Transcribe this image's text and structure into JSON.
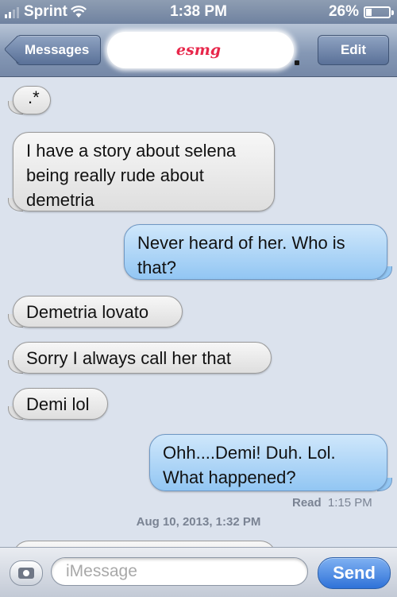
{
  "status_bar": {
    "carrier": "Sprint",
    "time": "1:38 PM",
    "battery_percent": "26%",
    "battery_level": 0.26,
    "signal_bars": 2,
    "wifi_icon": "wifi-icon"
  },
  "nav": {
    "back_label": "Messages",
    "title": "esmg",
    "edit_label": "Edit"
  },
  "messages": [
    {
      "direction": "in",
      "text": ".*"
    },
    {
      "direction": "in",
      "text": "I have a story about selena being really rude about demetria"
    },
    {
      "direction": "out",
      "text": "Never heard of her. Who is that?"
    },
    {
      "direction": "in",
      "text": "Demetria lovato"
    },
    {
      "direction": "in",
      "text": "Sorry I always call her that"
    },
    {
      "direction": "in",
      "text": "Demi lol"
    },
    {
      "direction": "out",
      "text": "Ohh....Demi!  Duh. Lol. What happened?"
    }
  ],
  "read_receipt": {
    "label": "Read",
    "time": "1:15 PM"
  },
  "timestamp": "Aug 10, 2013, 1:32 PM",
  "input_bar": {
    "camera_icon": "camera-icon",
    "placeholder": "iMessage",
    "send_label": "Send"
  },
  "colors": {
    "outgoing_bubble": "#92c6f3",
    "incoming_bubble": "#dedede",
    "send_button": "#2f72d8",
    "nav_bar": "#7588a7"
  }
}
